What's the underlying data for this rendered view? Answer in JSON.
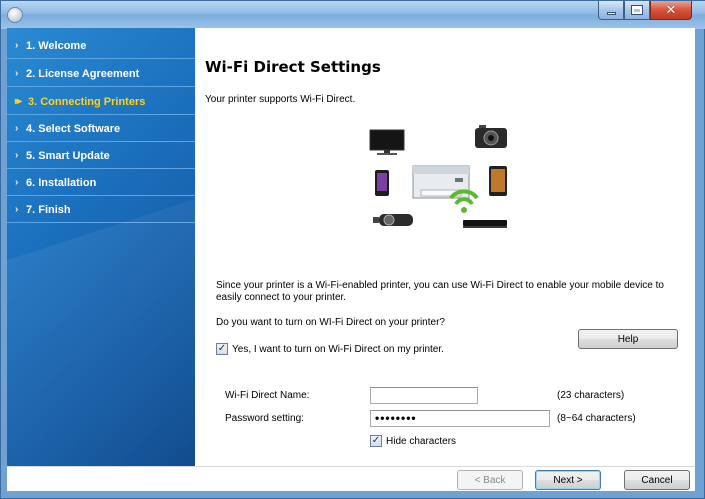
{
  "window": {
    "controls": {
      "minimize": "minimize-icon",
      "maximize": "maximize-icon",
      "close": "close-icon"
    }
  },
  "sidebar": {
    "items": [
      {
        "label": "1. Welcome",
        "active": false
      },
      {
        "label": "2. License Agreement",
        "active": false
      },
      {
        "label": "3. Connecting Printers",
        "active": true
      },
      {
        "label": "4. Select Software",
        "active": false
      },
      {
        "label": "5. Smart Update",
        "active": false
      },
      {
        "label": "6. Installation",
        "active": false
      },
      {
        "label": "7. Finish",
        "active": false
      }
    ]
  },
  "main": {
    "title": "Wi-Fi Direct Settings",
    "subtitle": "Your printer supports Wi-Fi Direct.",
    "description": "Since your printer is a Wi-Fi-enabled printer, you can use Wi-Fi Direct to enable your mobile device to easily connect to your printer.",
    "question": "Do you want to turn on WI-Fi Direct on your printer?",
    "help_label": "Help",
    "enable_checkbox": {
      "label": "Yes, I want to turn on Wi-Fi Direct on my printer.",
      "checked": true
    },
    "wifi_name": {
      "label": "Wi-Fi Direct Name:",
      "value": "",
      "hint": "(23 characters)"
    },
    "password": {
      "label": "Password setting:",
      "value": "••••••••",
      "hint": "(8~64 characters)"
    },
    "hide_checkbox": {
      "label": "Hide characters",
      "checked": true
    }
  },
  "footer": {
    "back_label": "< Back",
    "next_label": "Next >",
    "cancel_label": "Cancel"
  },
  "colors": {
    "sidebar_bg": "#1b6fbd",
    "active_nav": "#ffd21a",
    "wifi_icon": "#5cb82e"
  }
}
